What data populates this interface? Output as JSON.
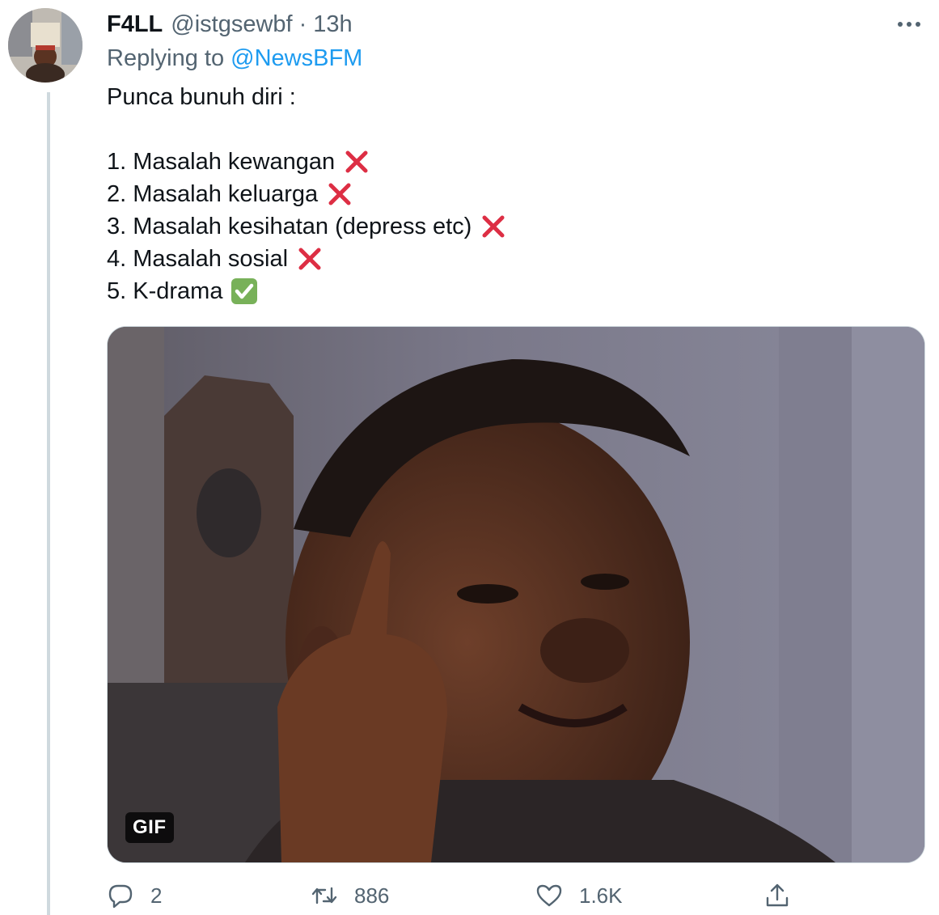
{
  "tweet": {
    "author": {
      "display_name": "F4LL",
      "handle": "@istgsewbf",
      "avatar_icon": "profile-photo"
    },
    "separator": "·",
    "time_ago": "13h",
    "replying_prefix": "Replying to",
    "replying_to": "@NewsBFM",
    "text_lines": [
      "Punca bunuh diri :",
      "1. Masalah kewangan",
      "2. Masalah keluarga",
      "3. Masalah kesihatan (depress etc)",
      "4. Masalah sosial",
      "5. K-drama"
    ],
    "media": {
      "badge": "GIF"
    },
    "actions": {
      "replies": "2",
      "retweets": "886",
      "likes": "1.6K"
    }
  },
  "colors": {
    "primary_text": "#0f1419",
    "secondary_text": "#536471",
    "link": "#1d9bf0",
    "thread_line": "#cfd9de",
    "cross_mark": "#dd2e44",
    "check_mark": "#78b159"
  },
  "icons": {
    "more": "more-horizontal-icon",
    "cross": "cross-mark-emoji",
    "check": "check-mark-button-emoji",
    "reply": "reply-bubble-icon",
    "retweet": "retweet-icon",
    "like": "heart-icon",
    "share": "share-upload-icon"
  }
}
